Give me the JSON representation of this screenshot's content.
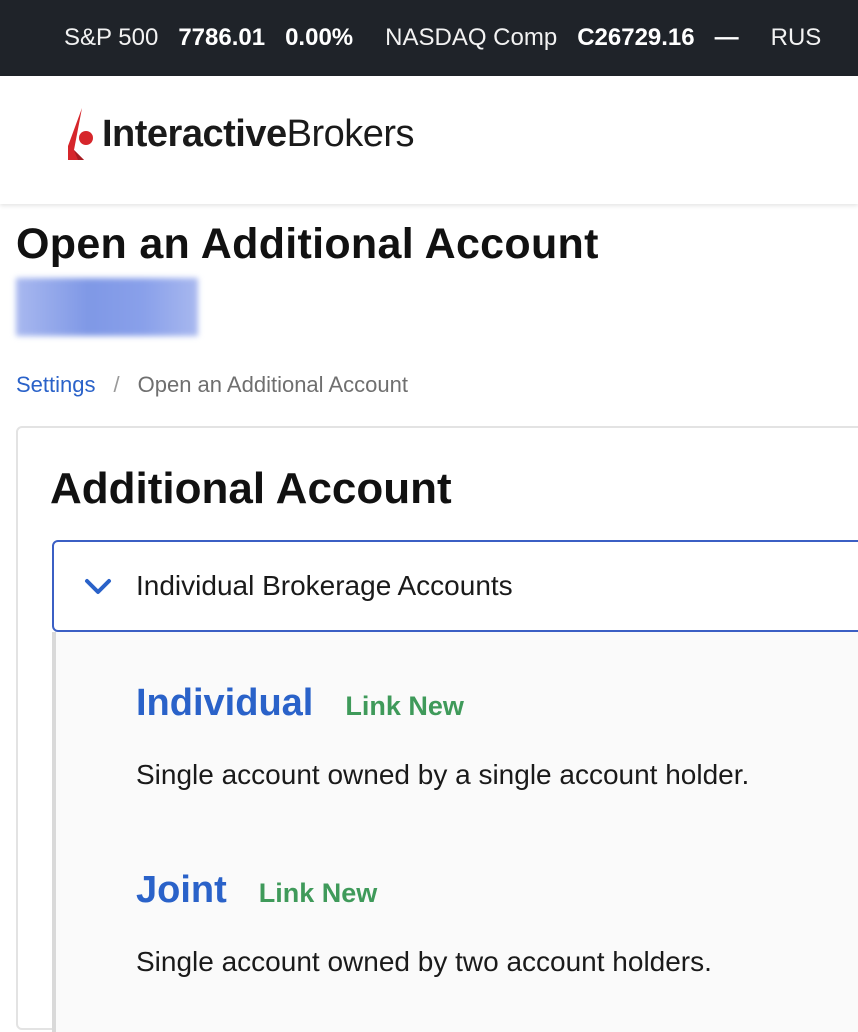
{
  "ticker": [
    {
      "name": "S&P 500",
      "value": "7786.01",
      "change": "0.00%"
    },
    {
      "name": "NASDAQ Comp",
      "value": "C26729.16",
      "change": "—"
    },
    {
      "name": "RUS",
      "value": "",
      "change": ""
    }
  ],
  "brand": {
    "bold": "Interactive",
    "regular": "Brokers",
    "accent_color": "#d6262b"
  },
  "page": {
    "title": "Open an Additional Account"
  },
  "breadcrumb": {
    "link": "Settings",
    "separator": "/",
    "current": "Open an Additional Account"
  },
  "card": {
    "title": "Additional Account",
    "section": {
      "label": "Individual Brokerage Accounts",
      "expanded": true,
      "accounts": [
        {
          "name": "Individual",
          "action": "Link New",
          "description": "Single account owned by a single account holder."
        },
        {
          "name": "Joint",
          "action": "Link New",
          "description": "Single account owned by two account holders."
        }
      ]
    }
  },
  "colors": {
    "link": "#2a62c9",
    "success": "#3f9a5a",
    "ticker_bg": "#1f2329",
    "accordion_border": "#3b5fc4"
  }
}
